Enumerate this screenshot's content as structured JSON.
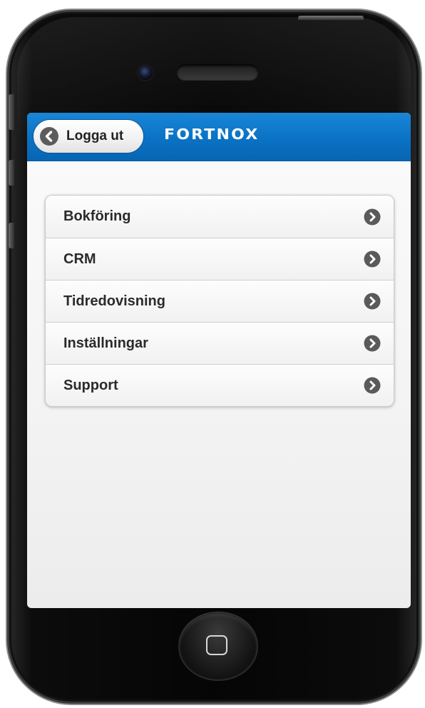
{
  "header": {
    "logout_label": "Logga ut",
    "brand": "FORTNOX"
  },
  "menu": {
    "items": [
      {
        "label": "Bokföring"
      },
      {
        "label": "CRM"
      },
      {
        "label": "Tidredovisning"
      },
      {
        "label": "Inställningar"
      },
      {
        "label": "Support"
      }
    ]
  },
  "colors": {
    "header_blue": "#0a72c4",
    "chevron_gray": "#5a5a5a",
    "phone_body": "#050505"
  },
  "icons": {
    "back": "back-arrow-icon",
    "chevron": "chevron-right-icon",
    "home": "home-button-icon"
  }
}
